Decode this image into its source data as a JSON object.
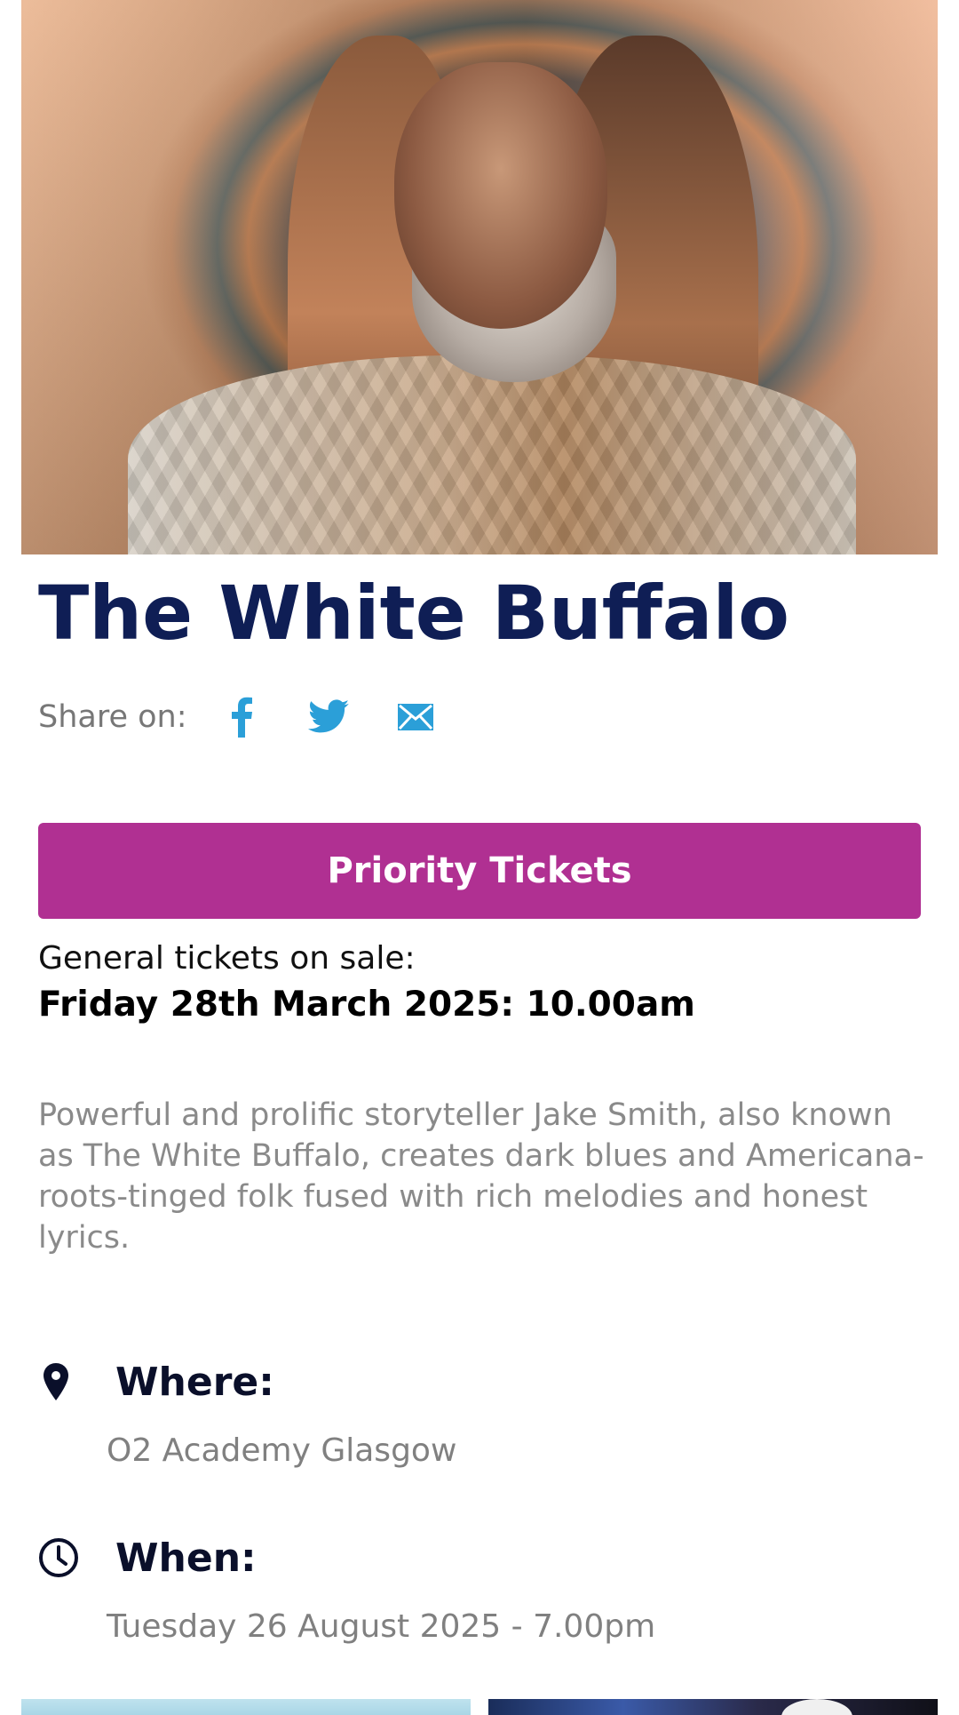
{
  "event": {
    "title": "The White Buffalo",
    "hero_alt": "Photo of The White Buffalo"
  },
  "share": {
    "label": "Share on:",
    "icons": [
      "facebook-icon",
      "twitter-icon",
      "email-icon"
    ],
    "icon_color": "#2b9fd8"
  },
  "tickets": {
    "priority_label": "Priority Tickets",
    "button_color": "#b03092",
    "general_label": "General tickets on sale:",
    "general_date": "Friday 28th March 2025: 10.00am"
  },
  "description": "Powerful and prolific storyteller Jake Smith, also known as The White Buffalo, creates dark blues and Americana-roots-tinged folk fused with rich melodies and honest lyrics.",
  "details": {
    "where_label": "Where:",
    "where_value": "O2 Academy Glasgow",
    "when_label": "When:",
    "when_value": "Tuesday 26 August 2025 - 7.00pm"
  },
  "colors": {
    "title": "#0f1e55",
    "muted_text": "#808080"
  }
}
